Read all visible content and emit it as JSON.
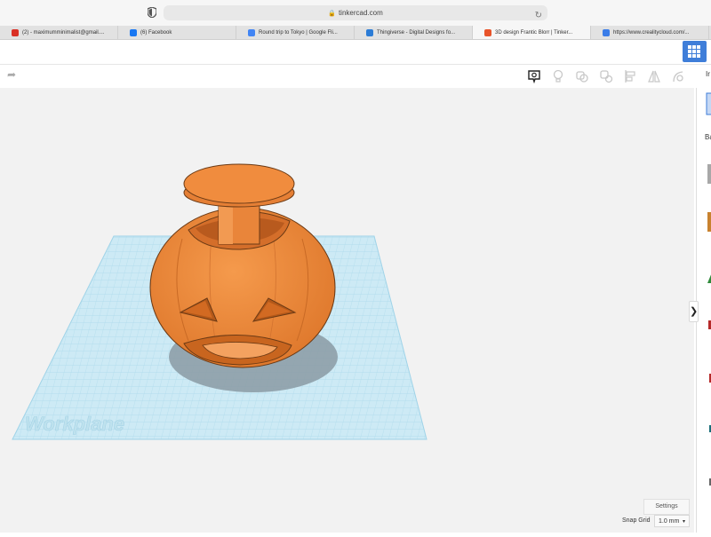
{
  "browser": {
    "url": "tinkercad.com",
    "tabs": [
      {
        "label": "(2) - maximumminimalist@gmail....",
        "icon": "gmail-icon",
        "color": "#d93025"
      },
      {
        "label": "(6) Facebook",
        "icon": "facebook-icon",
        "color": "#1877f2"
      },
      {
        "label": "Round trip to Tokyo | Google Fli...",
        "icon": "google-flights-icon",
        "color": "#4285f4"
      },
      {
        "label": "Thingiverse - Digital Designs fo...",
        "icon": "thingiverse-icon",
        "color": "#2c7cd6"
      },
      {
        "label": "3D design Frantic Blorr | Tinker...",
        "icon": "tinkercad-icon",
        "color": "#e8542a",
        "active": true
      },
      {
        "label": "https://www.crealitycloud.com/...",
        "icon": "creality-icon",
        "color": "#3b7de8"
      }
    ]
  },
  "app": {
    "panel_label": "Ir",
    "viewport": {
      "workplane_label": "Workplane",
      "shape_color": "#ef8a3c",
      "grid_color": "#9fd3e8"
    },
    "settings_label": "Settings",
    "snap_grid": {
      "label": "Snap Grid",
      "value": "1.0 mm"
    }
  }
}
